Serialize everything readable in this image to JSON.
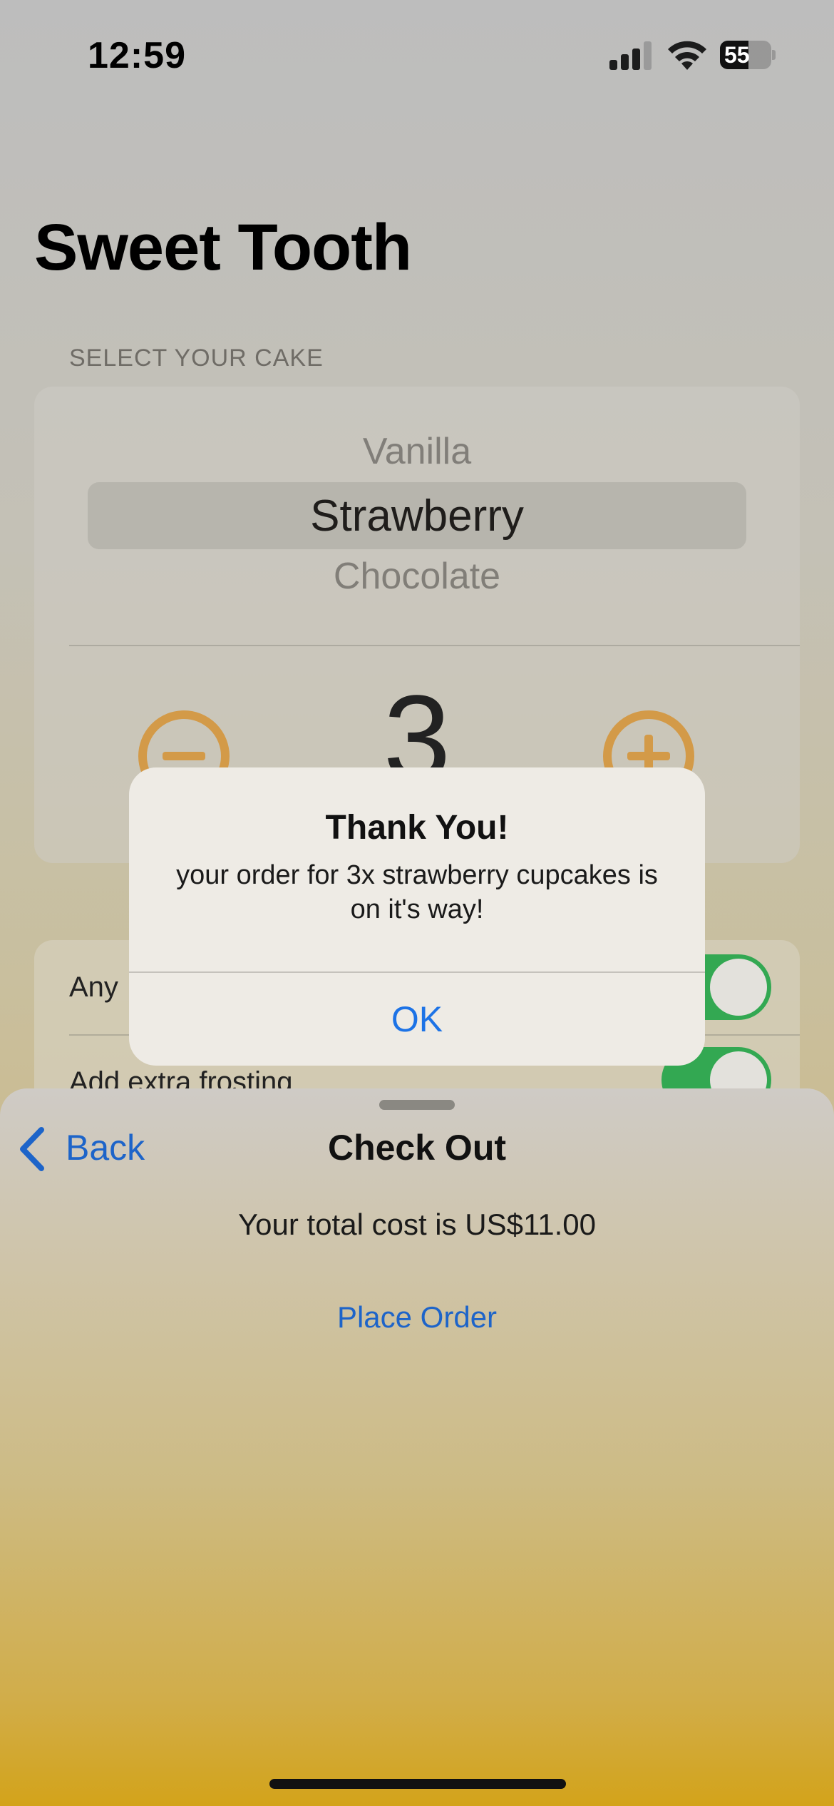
{
  "status_bar": {
    "time": "12:59",
    "battery_level": "55"
  },
  "app": {
    "title": "Sweet Tooth"
  },
  "cake_section": {
    "label": "SELECT YOUR CAKE",
    "picker_options": [
      "Vanilla",
      "Strawberry",
      "Chocolate"
    ],
    "selected": "Strawberry",
    "quantity": "3"
  },
  "options": {
    "items": [
      {
        "label": "Any",
        "enabled": true
      },
      {
        "label": "Add extra frosting",
        "enabled": true
      }
    ]
  },
  "checkout_sheet": {
    "back_label": "Back",
    "title": "Check Out",
    "total_text": "Your total cost is US$11.00",
    "place_order_label": "Place Order"
  },
  "alert": {
    "title": "Thank You!",
    "message": "your order for 3x strawberry cupcakes is on it's way!",
    "ok_label": "OK"
  },
  "colors": {
    "accent_blue": "#1d64c9",
    "stepper_orange": "#d39a48",
    "toggle_green": "#33a852"
  }
}
